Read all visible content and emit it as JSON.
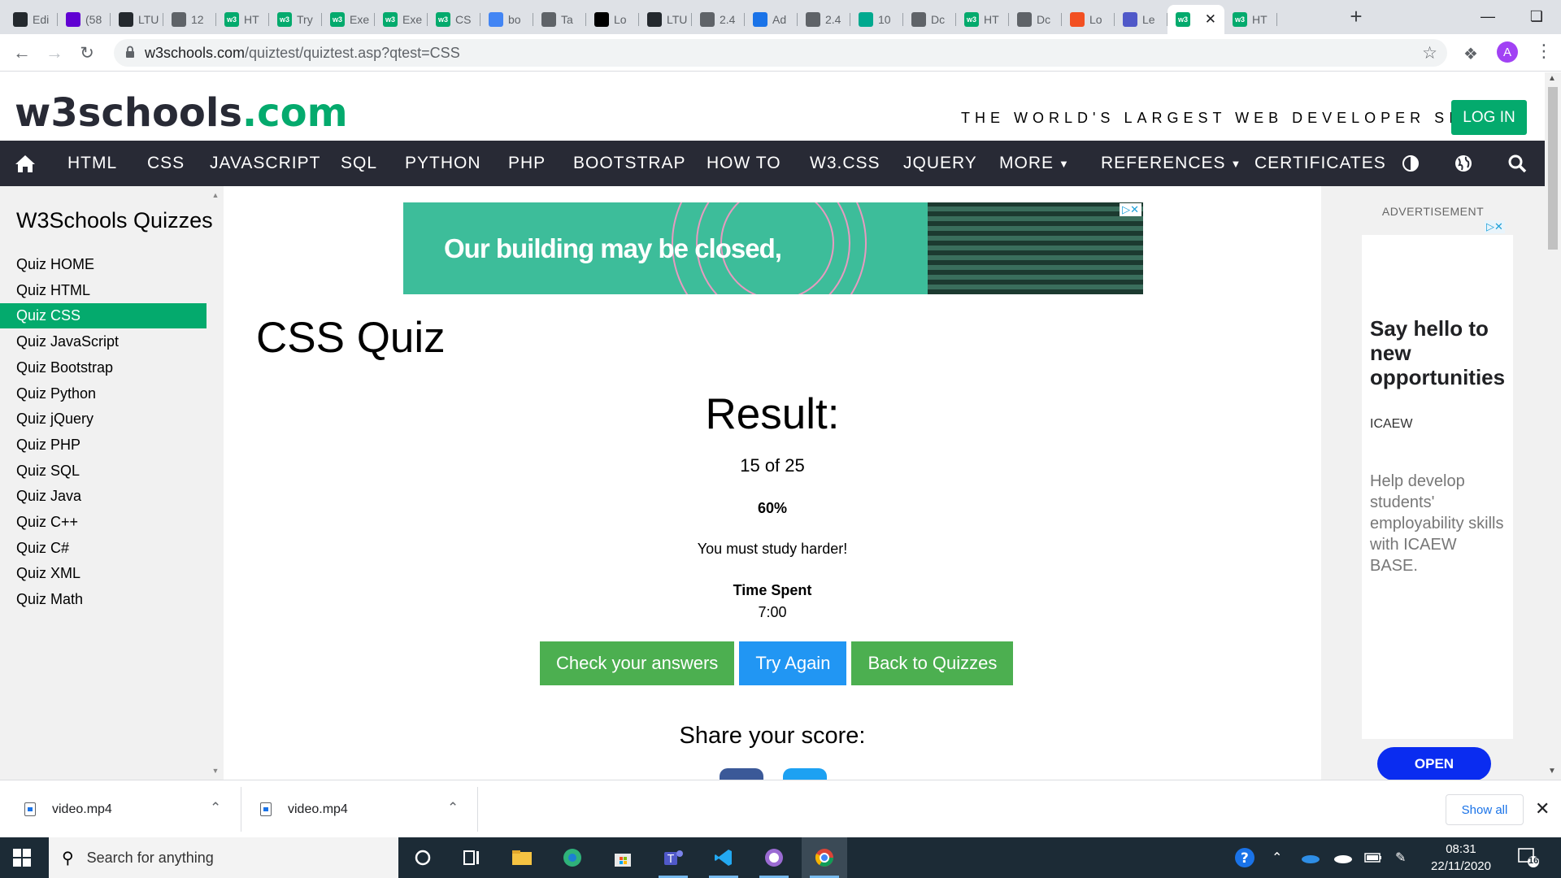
{
  "browser": {
    "tabs": [
      {
        "label": "Edi",
        "favicon": "github",
        "color": "#24292e"
      },
      {
        "label": "(58",
        "favicon": "yahoo-mail",
        "color": "#6001d2"
      },
      {
        "label": "LTU",
        "favicon": "github",
        "color": "#24292e"
      },
      {
        "label": "12",
        "favicon": "globe",
        "color": "#5f6368"
      },
      {
        "label": "HT",
        "favicon": "w3schools",
        "color": "#04aa6d"
      },
      {
        "label": "Try",
        "favicon": "w3schools",
        "color": "#04aa6d"
      },
      {
        "label": "Exe",
        "favicon": "w3schools",
        "color": "#04aa6d"
      },
      {
        "label": "Exe",
        "favicon": "w3schools",
        "color": "#04aa6d"
      },
      {
        "label": "CS",
        "favicon": "w3schools",
        "color": "#04aa6d"
      },
      {
        "label": "bo",
        "favicon": "google",
        "color": "#4285f4"
      },
      {
        "label": "Ta",
        "favicon": "globe",
        "color": "#5f6368"
      },
      {
        "label": "Lo",
        "favicon": "letter-l",
        "color": "#000000"
      },
      {
        "label": "LTU",
        "favicon": "github",
        "color": "#24292e"
      },
      {
        "label": "2.4",
        "favicon": "globe",
        "color": "#5f6368"
      },
      {
        "label": "Ad",
        "favicon": "ad-icon",
        "color": "#1a73e8"
      },
      {
        "label": "2.4",
        "favicon": "globe",
        "color": "#5f6368"
      },
      {
        "label": "10",
        "favicon": "d-icon",
        "color": "#00a98f"
      },
      {
        "label": "Dc",
        "favicon": "globe",
        "color": "#5f6368"
      },
      {
        "label": "HT",
        "favicon": "w3schools",
        "color": "#04aa6d"
      },
      {
        "label": "Dc",
        "favicon": "globe",
        "color": "#5f6368"
      },
      {
        "label": "Lo",
        "favicon": "microsoft",
        "color": "#f25022"
      },
      {
        "label": "Le",
        "favicon": "teams",
        "color": "#5059c9"
      },
      {
        "label": "",
        "favicon": "w3schools",
        "color": "#04aa6d",
        "active": true
      },
      {
        "label": "HT",
        "favicon": "w3schools",
        "color": "#04aa6d"
      }
    ],
    "url_host": "w3schools.com",
    "url_path": "/quiztest/quiztest.asp?qtest=CSS",
    "profile_initial": "A"
  },
  "site": {
    "logo_main": "w3schools",
    "logo_suffix": ".com",
    "tagline": "THE WORLD'S LARGEST WEB DEVELOPER SITE",
    "login": "LOG IN",
    "nav": [
      {
        "label": "HTML"
      },
      {
        "label": "CSS"
      },
      {
        "label": "JAVASCRIPT"
      },
      {
        "label": "SQL"
      },
      {
        "label": "PYTHON"
      },
      {
        "label": "PHP"
      },
      {
        "label": "BOOTSTRAP"
      },
      {
        "label": "HOW TO"
      },
      {
        "label": "W3.CSS"
      },
      {
        "label": "JQUERY"
      },
      {
        "label": "MORE"
      },
      {
        "label": "REFERENCES"
      },
      {
        "label": "CERTIFICATES"
      }
    ]
  },
  "sidebar": {
    "title": "W3Schools Quizzes",
    "items": [
      {
        "label": "Quiz HOME"
      },
      {
        "label": "Quiz HTML"
      },
      {
        "label": "Quiz CSS",
        "active": true
      },
      {
        "label": "Quiz JavaScript"
      },
      {
        "label": "Quiz Bootstrap"
      },
      {
        "label": "Quiz Python"
      },
      {
        "label": "Quiz jQuery"
      },
      {
        "label": "Quiz PHP"
      },
      {
        "label": "Quiz SQL"
      },
      {
        "label": "Quiz Java"
      },
      {
        "label": "Quiz C++"
      },
      {
        "label": "Quiz C#"
      },
      {
        "label": "Quiz XML"
      },
      {
        "label": "Quiz Math"
      }
    ]
  },
  "main": {
    "banner_text": "Our building may be closed,",
    "page_title": "CSS Quiz",
    "result_title": "Result:",
    "score": "15 of 25",
    "percent": "60%",
    "message": "You must study harder!",
    "time_label": "Time Spent",
    "time_value": "7:00",
    "buttons": {
      "check": "Check your answers",
      "retry": "Try Again",
      "back": "Back to Quizzes"
    },
    "share_title": "Share your score:"
  },
  "ad": {
    "label": "ADVERTISEMENT",
    "headline": "Say hello to new opportunities",
    "brand": "ICAEW",
    "body": "Help develop students' employability skills with ICAEW BASE.",
    "cta": "OPEN"
  },
  "downloads": {
    "items": [
      {
        "name": "video.mp4"
      },
      {
        "name": "video.mp4"
      }
    ],
    "show_all": "Show all"
  },
  "taskbar": {
    "search_placeholder": "Search for anything",
    "time": "08:31",
    "date": "22/11/2020",
    "notifications": "16"
  }
}
